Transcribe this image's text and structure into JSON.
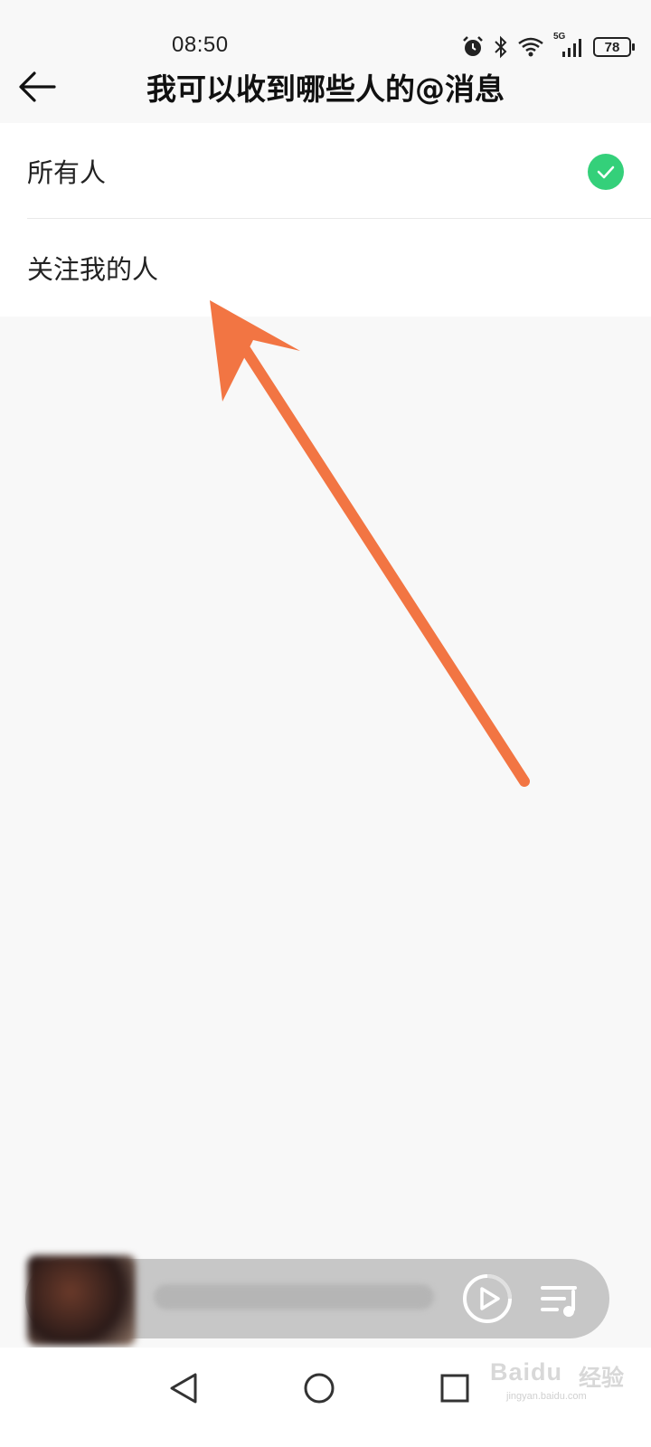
{
  "status_bar": {
    "time": "08:50",
    "network": "5G",
    "battery": "78",
    "icons": [
      "alarm-icon",
      "bluetooth-icon",
      "wifi-icon",
      "signal-icon",
      "battery-icon"
    ]
  },
  "header": {
    "title": "我可以收到哪些人的@消息",
    "back_icon": "back-arrow-icon"
  },
  "options": [
    {
      "label": "所有人",
      "selected": true
    },
    {
      "label": "关注我的人",
      "selected": false
    }
  ],
  "annotation": {
    "type": "arrow",
    "color": "#f27543"
  },
  "mini_player": {
    "play_icon": "play-icon",
    "playlist_icon": "playlist-icon"
  },
  "nav_bar": {
    "icons": [
      "nav-back-icon",
      "nav-home-icon",
      "nav-recent-icon"
    ]
  },
  "watermark": {
    "logo": "Baidu",
    "cn": "经验",
    "url": "jingyan.baidu.com"
  },
  "colors": {
    "accent_check": "#34d07a",
    "background": "#f8f8f8",
    "arrow": "#f27543"
  }
}
